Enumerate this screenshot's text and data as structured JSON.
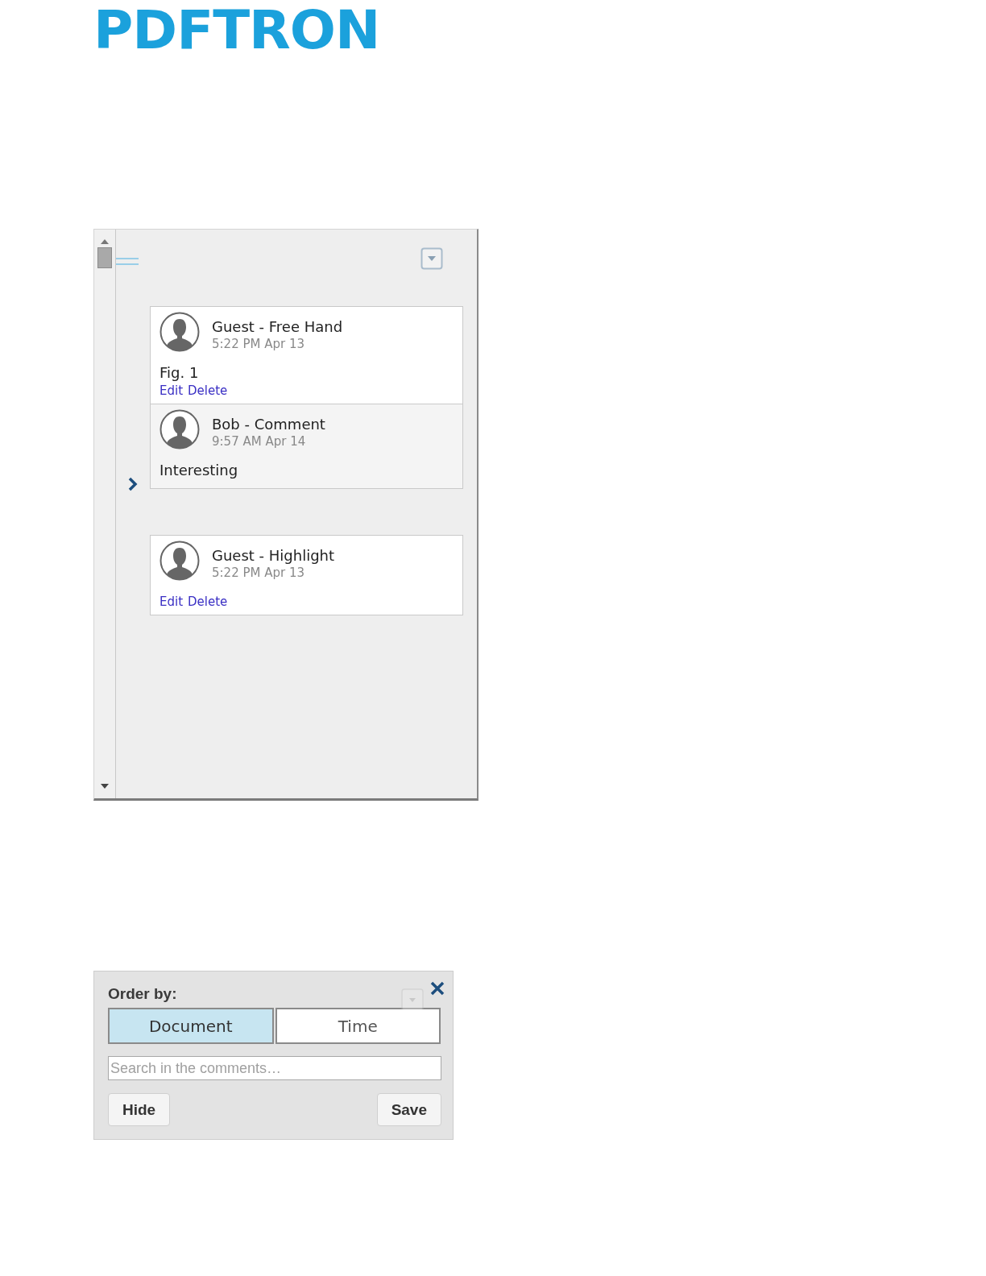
{
  "logo": {
    "text": "PDFTRON"
  },
  "notes_panel": {
    "threads": [
      {
        "expanded": false,
        "notes": [
          {
            "kind": "annotation",
            "author_line": "Guest - Free Hand",
            "time": "5:22 PM Apr 13",
            "body": "Fig. 1",
            "actions": [
              "Edit",
              "Delete"
            ]
          },
          {
            "kind": "reply",
            "author_line": "Bob - Comment",
            "time": "9:57 AM Apr 14",
            "body": "Interesting"
          }
        ]
      },
      {
        "notes": [
          {
            "kind": "annotation",
            "author_line": "Guest - Highlight",
            "time": "5:22 PM Apr 13",
            "actions": [
              "Edit",
              "Delete"
            ]
          }
        ]
      }
    ]
  },
  "sort_panel": {
    "label": "Order by:",
    "tabs": [
      {
        "label": "Document",
        "selected": true
      },
      {
        "label": "Time",
        "selected": false
      }
    ],
    "search": {
      "placeholder": "Search in the comments…"
    },
    "buttons": [
      "Hide",
      "Save"
    ]
  }
}
